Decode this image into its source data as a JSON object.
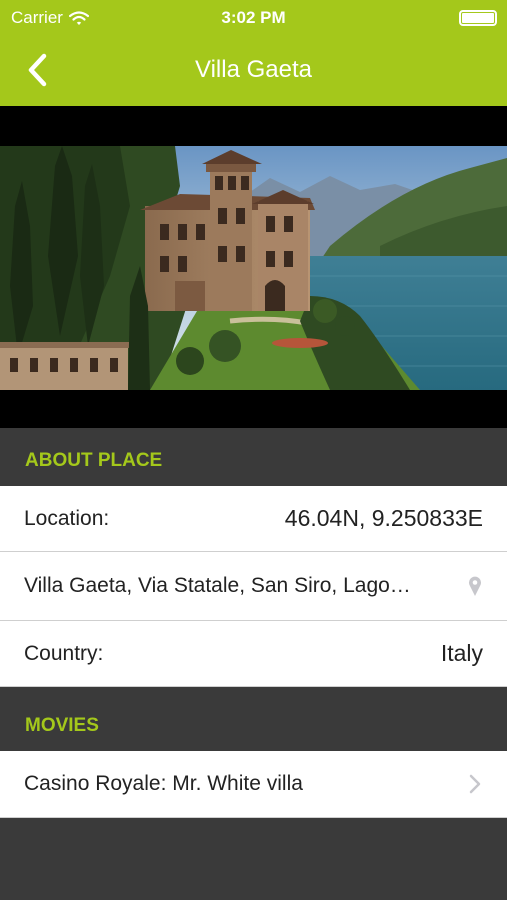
{
  "status_bar": {
    "carrier": "Carrier",
    "time": "3:02 PM",
    "battery_level": 1.0
  },
  "nav": {
    "title": "Villa Gaeta",
    "back_icon": "chevron-left-icon"
  },
  "hero_image": {
    "subject": "villa-on-lake-photo"
  },
  "sections": {
    "about": {
      "header": "ABOUT PLACE",
      "location_label": "Location:",
      "location_value": "46.04N, 9.250833E",
      "address": "Villa Gaeta, Via Statale, San Siro, Lago…",
      "address_icon": "map-pin-icon",
      "country_label": "Country:",
      "country_value": "Italy"
    },
    "movies": {
      "header": "MOVIES",
      "items": [
        {
          "title": "Casino Royale: Mr. White villa",
          "icon": "chevron-right-icon"
        }
      ]
    }
  },
  "colors": {
    "accent": "#a4c81b",
    "section_bg": "#3a3a3a",
    "row_bg": "#ffffff",
    "text": "#222222"
  }
}
